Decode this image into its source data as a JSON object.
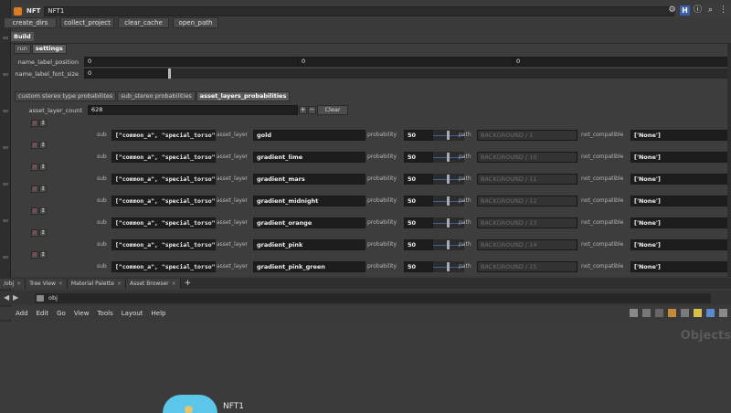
{
  "window": {
    "node_type": "NFT",
    "node_name": "NFT1"
  },
  "top_buttons": [
    "create_dirs",
    "collect_project",
    "clear_cache",
    "open_path"
  ],
  "build_label": "Build",
  "main_tabs": [
    "run",
    "settings"
  ],
  "settings": {
    "name_label_position": {
      "label": "name_label_position",
      "values": [
        "0",
        "0",
        "0"
      ]
    },
    "name_label_font_size": {
      "label": "name_label_font_size",
      "value": "0"
    }
  },
  "sub_tabs": [
    "custom stereo type probabilites",
    "sub_stereo probabilities",
    "asset_layers_probabilities"
  ],
  "asset_layer_count": {
    "label": "asset_layer_count",
    "value": "628",
    "clear_label": "Clear"
  },
  "row_labels": {
    "sub": "sub",
    "asset_layer": "asset_layer",
    "probability": "probability",
    "path": "path",
    "not_compatible": "not_compatible"
  },
  "rows": [
    {
      "sub": "[\"common_a\", \"special_torso\"]",
      "asset_layer": "gold",
      "probability": "50",
      "path": "BACKGROUND / 1",
      "not_compatible": "['None']"
    },
    {
      "sub": "[\"common_a\", \"special_torso\"]",
      "asset_layer": "gradient_lime",
      "probability": "50",
      "path": "BACKGROUND / 10",
      "not_compatible": "['None']"
    },
    {
      "sub": "[\"common_a\", \"special_torso\"]",
      "asset_layer": "gradient_mars",
      "probability": "50",
      "path": "BACKGROUND / 11",
      "not_compatible": "['None']"
    },
    {
      "sub": "[\"common_a\", \"special_torso\"]",
      "asset_layer": "gradient_midnight",
      "probability": "50",
      "path": "BACKGROUND / 12",
      "not_compatible": "['None']"
    },
    {
      "sub": "[\"common_a\", \"special_torso\"]",
      "asset_layer": "gradient_orange",
      "probability": "50",
      "path": "BACKGROUND / 13",
      "not_compatible": "['None']"
    },
    {
      "sub": "[\"common_a\", \"special_torso\"]",
      "asset_layer": "gradient_pink",
      "probability": "50",
      "path": "BACKGROUND / 14",
      "not_compatible": "['None']"
    },
    {
      "sub": "[\"common_a\", \"special_torso\"]",
      "asset_layer": "gradient_pink_green",
      "probability": "50",
      "path": "BACKGROUND / 15",
      "not_compatible": "['None']"
    }
  ],
  "network_tabs": [
    "/obj",
    "Tree View",
    "Material Palette",
    "Asset Browser"
  ],
  "path_value": "obj",
  "menu": [
    "Add",
    "Edit",
    "Go",
    "View",
    "Tools",
    "Layout",
    "Help"
  ],
  "network_context_label": "Objects",
  "node": {
    "name": "NFT1"
  },
  "colors": {
    "accent": "#e07b1f",
    "node_color": "#5bc6e8",
    "slider_line": "#3f5f9f"
  }
}
